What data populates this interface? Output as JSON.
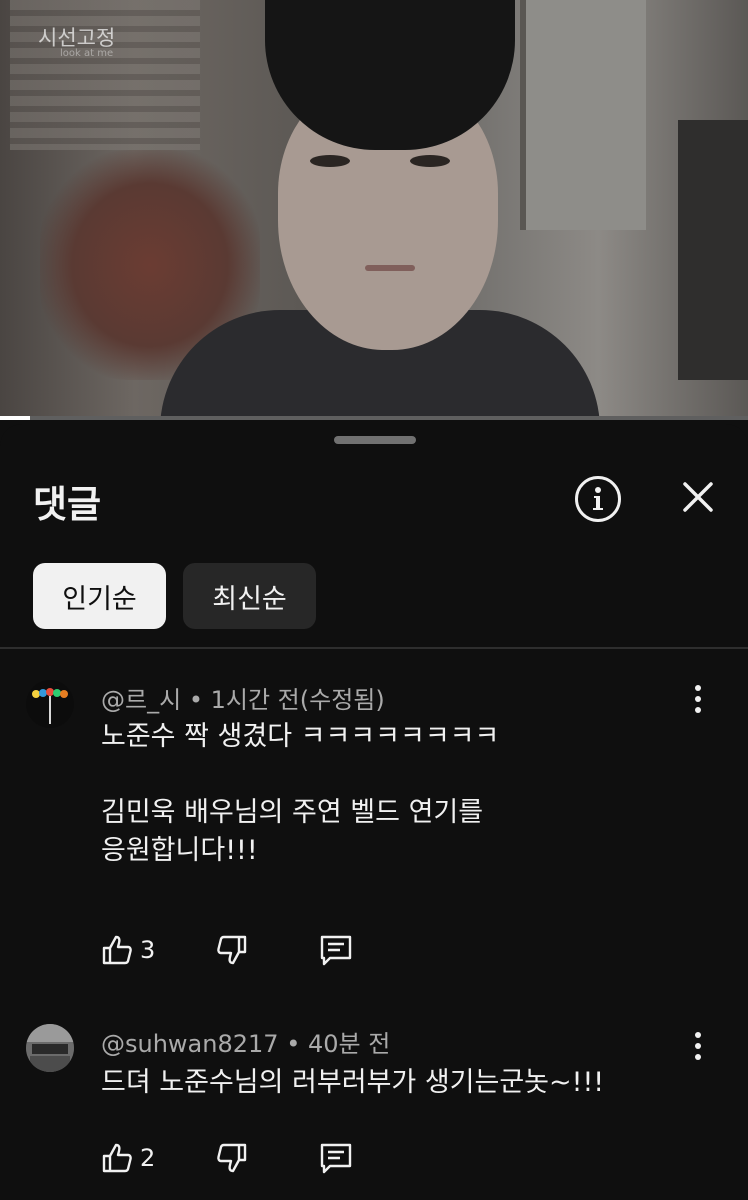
{
  "video": {
    "watermark": "시선고정",
    "watermark_sub": "look at me",
    "progress_fraction": 0.04
  },
  "panel": {
    "title": "댓글",
    "info_icon": "info-circle-icon",
    "close_icon": "close-icon",
    "tabs": [
      {
        "label": "인기순",
        "selected": true
      },
      {
        "label": "최신순",
        "selected": false
      }
    ]
  },
  "comments": [
    {
      "author": "@르_시",
      "time": "1시간 전(수정됨)",
      "lines": [
        "노준수 짝 생겼다 ㅋㅋㅋㅋㅋㅋㅋㅋ",
        "",
        "김민욱 배우님의 주연 벨드 연기를",
        "응원합니다!!!"
      ],
      "likes": "3"
    },
    {
      "author": "@suhwan8217",
      "time": "40분 전",
      "lines": [
        "드뎌 노준수님의 러부러부가 생기는군놋~!!!"
      ],
      "likes": "2"
    }
  ],
  "colors": {
    "background": "#0f0f0f",
    "text": "#f1f1f1",
    "meta": "#aaaaaa",
    "chip_active": "#f1f1f1",
    "chip_idle": "#272727"
  }
}
